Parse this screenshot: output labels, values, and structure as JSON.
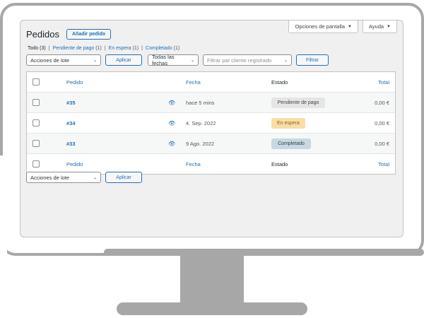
{
  "screen_options": {
    "options_label": "Opciones de pantalla",
    "help_label": "Ayuda"
  },
  "header": {
    "title": "Pedidos",
    "add_button": "Añadir pedido"
  },
  "views": {
    "all": "Todo",
    "all_count": "(3)",
    "pending": "Pendiente de pago",
    "pending_count": "(1)",
    "hold": "En espera",
    "hold_count": "(1)",
    "completed": "Completado",
    "completed_count": "(1)",
    "sep": "|"
  },
  "filters": {
    "bulk_actions": "Acciones de lote",
    "apply": "Aplicar",
    "dates": "Todas las fechas",
    "customer_placeholder": "Filtrar par cliente registrado",
    "filter": "Filtrar"
  },
  "table": {
    "headers": {
      "order": "Pedido",
      "date": "Fecha",
      "status": "Estado",
      "total": "Total"
    },
    "rows": [
      {
        "order": "#35",
        "date": "hace 5 mins",
        "status": "Pendiente de pago",
        "total": "0,00 €"
      },
      {
        "order": "#34",
        "date": "4. Sep. 2022",
        "status": "En espera",
        "total": "0,00 €"
      },
      {
        "order": "#33",
        "date": "9 Ago. 2022",
        "status": "Completado",
        "total": "0,00 €"
      }
    ]
  },
  "bottom": {
    "bulk_actions": "Acciones de lote",
    "apply": "Aplicar"
  },
  "icons": {
    "preview": "eye-icon",
    "dropdown": "chevron-down-icon"
  },
  "colors": {
    "accent": "#2271b1",
    "pending": "#e5e5e5",
    "on_hold": "#f8dda7",
    "completed": "#c8d7e1"
  }
}
